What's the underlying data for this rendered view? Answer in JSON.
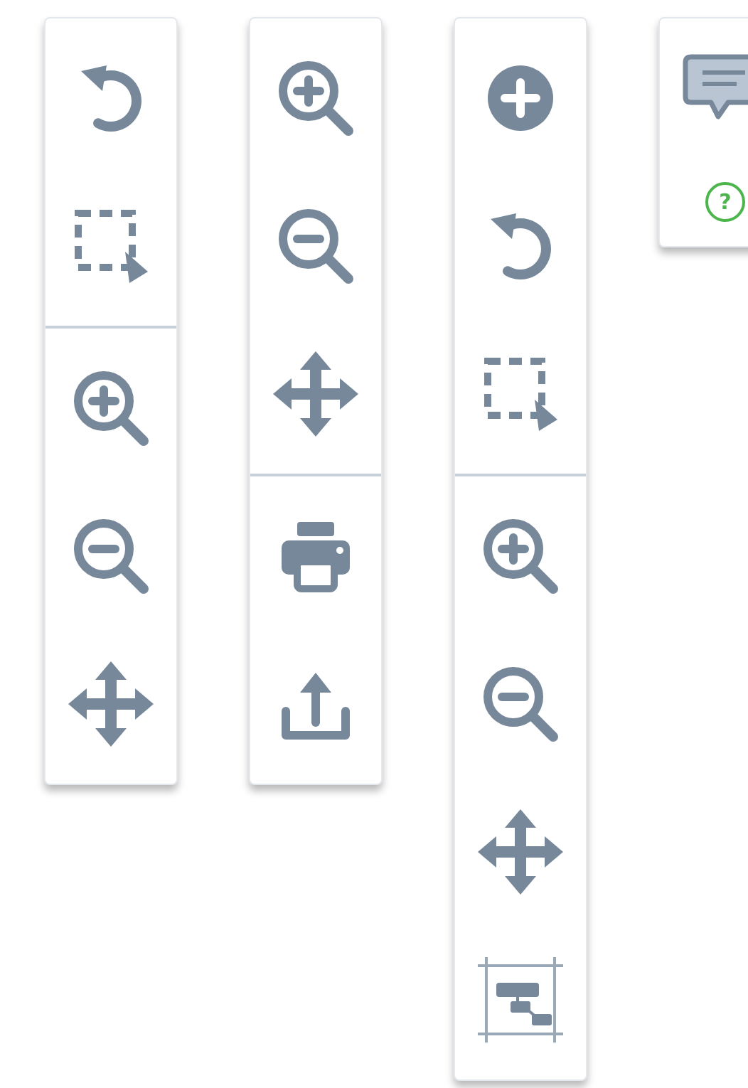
{
  "toolbars": [
    {
      "groups": [
        {
          "buttons": [
            {
              "kind": "undo"
            },
            {
              "kind": "select"
            }
          ]
        },
        {
          "buttons": [
            {
              "kind": "zoomin"
            },
            {
              "kind": "zoomout"
            },
            {
              "kind": "pan"
            }
          ]
        }
      ]
    },
    {
      "groups": [
        {
          "buttons": [
            {
              "kind": "zoomin"
            },
            {
              "kind": "zoomout"
            },
            {
              "kind": "pan"
            }
          ]
        },
        {
          "buttons": [
            {
              "kind": "print"
            },
            {
              "kind": "export"
            }
          ]
        }
      ]
    },
    {
      "groups": [
        {
          "buttons": [
            {
              "kind": "add"
            },
            {
              "kind": "undo"
            },
            {
              "kind": "select"
            }
          ]
        },
        {
          "buttons": [
            {
              "kind": "zoomin"
            },
            {
              "kind": "zoomout"
            },
            {
              "kind": "pan"
            },
            {
              "kind": "fit"
            }
          ]
        }
      ]
    },
    {
      "groups": [
        {
          "buttons": [
            {
              "kind": "comment"
            },
            {
              "kind": "help",
              "label": "?"
            }
          ]
        }
      ]
    }
  ]
}
